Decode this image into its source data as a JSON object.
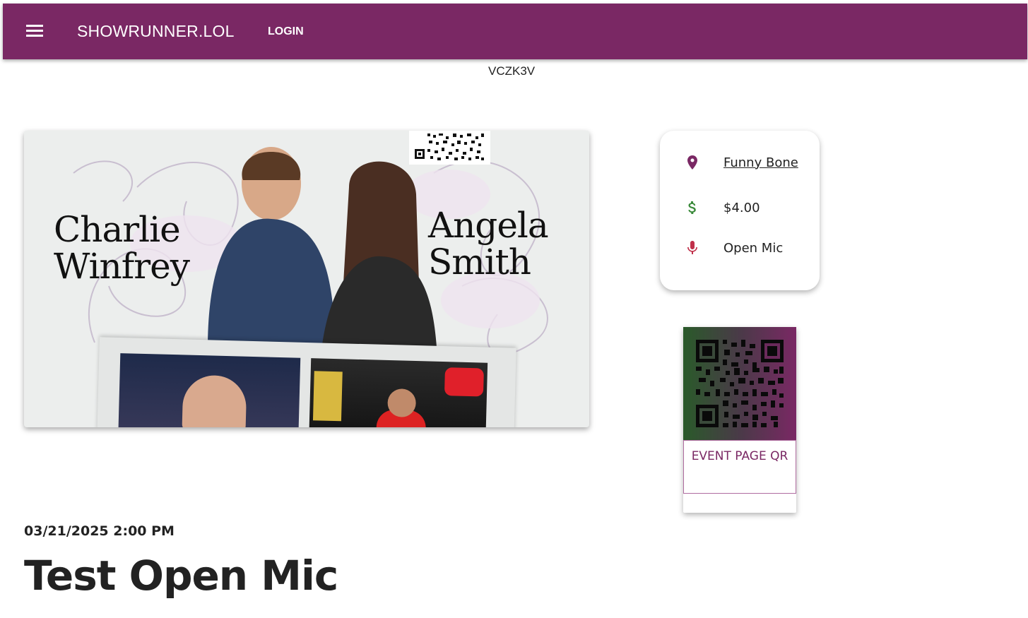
{
  "header": {
    "brand": "SHOWRUNNER.LOL",
    "login_label": "LOGIN",
    "background": "#7a2864"
  },
  "event_code": "VCZK3V",
  "flyer": {
    "performer_1": "Charlie Winfrey",
    "performer_2": "Angela Smith"
  },
  "info": {
    "venue": "Funny Bone",
    "price": "$4.00",
    "type": "Open Mic",
    "venue_icon": "location-pin-icon",
    "price_icon": "dollar-icon",
    "type_icon": "microphone-icon",
    "icon_colors": {
      "location": "#7a2864",
      "dollar": "#3a8a3a",
      "microphone": "#c0304a"
    }
  },
  "qr": {
    "button_label": "EVENT PAGE QR"
  },
  "event": {
    "datetime": "03/21/2025 2:00 PM",
    "title": "Test Open Mic"
  }
}
